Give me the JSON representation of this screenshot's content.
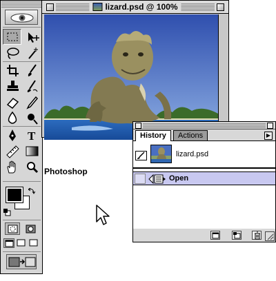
{
  "document": {
    "title": "lizard.psd @ 100%"
  },
  "page_label": "Photoshop",
  "history": {
    "tabs": [
      {
        "label": "History",
        "active": true
      },
      {
        "label": "Actions",
        "active": false
      }
    ],
    "snapshot_name": "lizard.psd",
    "states": [
      {
        "label": "Open",
        "selected": true
      }
    ],
    "buttons": [
      "new-document-from-state-icon",
      "new-snapshot-icon",
      "delete-state-icon"
    ]
  },
  "toolbox": {
    "tools": [
      "marquee",
      "move",
      "lasso",
      "magic-wand",
      "crop",
      "slice",
      "healing",
      "brush",
      "stamp",
      "history-brush",
      "eraser",
      "pencil",
      "blur",
      "dodge",
      "pen",
      "type",
      "measure",
      "gradient",
      "hand",
      "eyedropper",
      "zoom"
    ],
    "selected_tool": "marquee",
    "foreground_color": "#000000",
    "background_color": "#ffffff"
  },
  "colors": {
    "ui_gray": "#d6d6d6",
    "selection": "#c8c8f0"
  }
}
